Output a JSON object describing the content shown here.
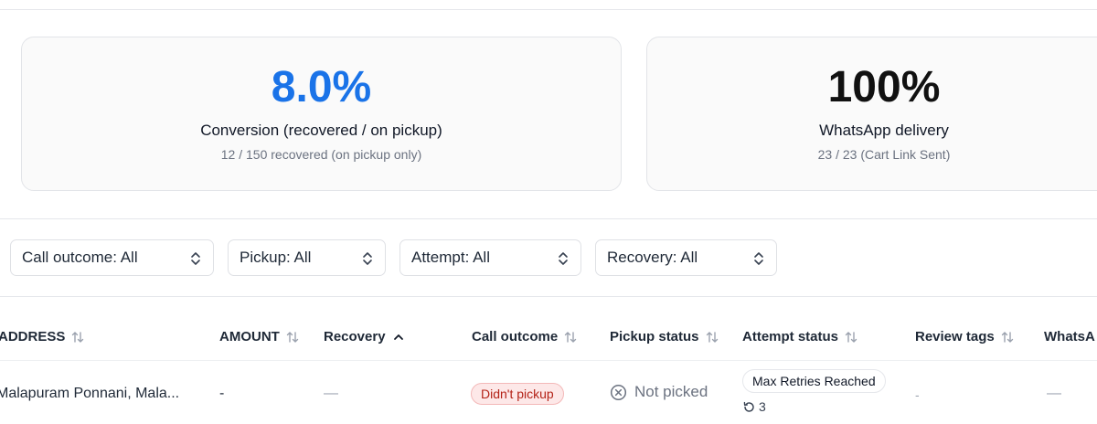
{
  "stats": [
    {
      "value": "8.0%",
      "label": "Conversion (recovered / on pickup)",
      "sub": "12 / 150 recovered (on pickup only)",
      "value_color": "#1a73e8"
    },
    {
      "value": "100%",
      "label": "WhatsApp delivery",
      "sub": "23 / 23 (Cart Link Sent)",
      "value_color": "#111111"
    }
  ],
  "filters": [
    {
      "label": "Call outcome: All"
    },
    {
      "label": "Pickup: All"
    },
    {
      "label": "Attempt: All"
    },
    {
      "label": "Recovery: All"
    }
  ],
  "table": {
    "columns": [
      "ADDRESS",
      "AMOUNT",
      "Recovery",
      "Call outcome",
      "Pickup status",
      "Attempt status",
      "Review tags",
      "WhatsA"
    ],
    "rows": [
      {
        "address": "Malapuram Ponnani, Mala...",
        "amount": "-",
        "recovery": "—",
        "call_outcome": "Didn't pickup",
        "pickup_status": "Not picked",
        "attempt_status": "Max Retries Reached",
        "attempt_count": "3",
        "review_tags": "-",
        "whatsapp": "—"
      }
    ]
  }
}
